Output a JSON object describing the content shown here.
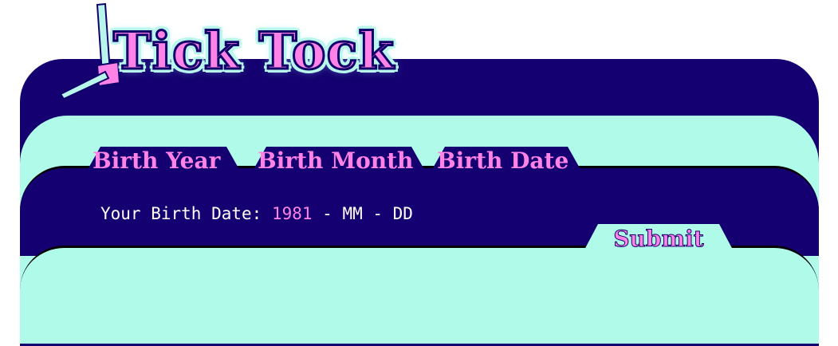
{
  "logo": {
    "text": "Tick Tock",
    "icon": "clock-hand-icon"
  },
  "tabs": [
    {
      "label": "Birth Year"
    },
    {
      "label": "Birth Month"
    },
    {
      "label": "Birth Date"
    }
  ],
  "prompt": {
    "label": "Your Birth Date: ",
    "year": "1981",
    "rest": " - MM - DD"
  },
  "submit": {
    "label": "Submit"
  },
  "colors": {
    "navy": "#140070",
    "mint": "#b0faea",
    "pink": "#ff82e6"
  }
}
